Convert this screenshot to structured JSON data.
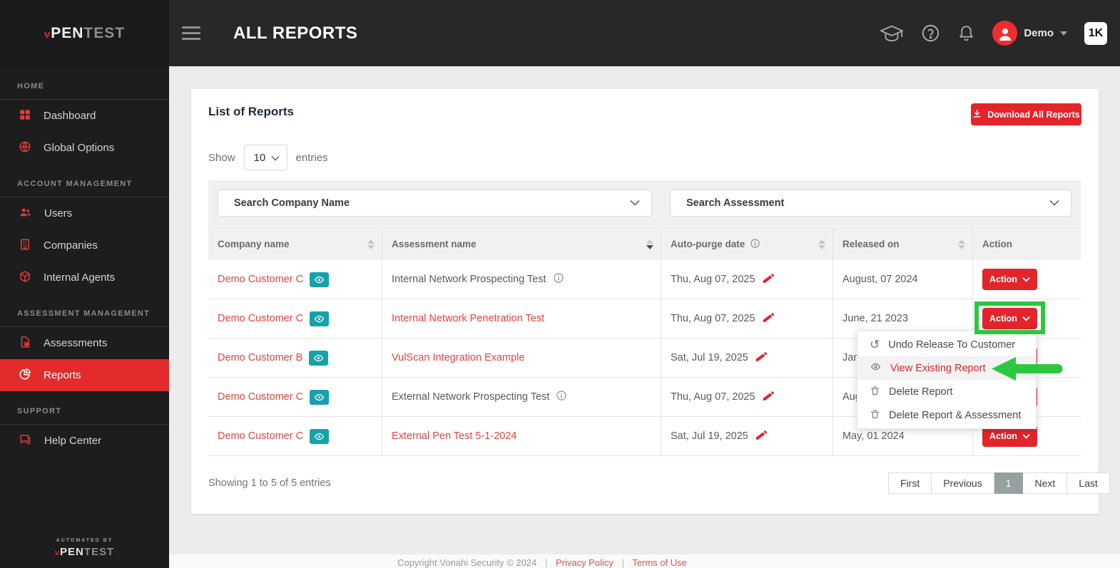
{
  "brand": {
    "v": "v",
    "pen": "PEN",
    "test": "TEST",
    "automated_by": "AUTOMATED BY"
  },
  "header": {
    "title": "ALL REPORTS",
    "user_name": "Demo",
    "corner_badge": "1K"
  },
  "sidebar": {
    "sections": [
      {
        "label": "HOME",
        "items": [
          {
            "label": "Dashboard"
          },
          {
            "label": "Global Options"
          }
        ]
      },
      {
        "label": "ACCOUNT MANAGEMENT",
        "items": [
          {
            "label": "Users"
          },
          {
            "label": "Companies"
          },
          {
            "label": "Internal Agents"
          }
        ]
      },
      {
        "label": "ASSESSMENT MANAGEMENT",
        "items": [
          {
            "label": "Assessments"
          },
          {
            "label": "Reports"
          }
        ]
      },
      {
        "label": "SUPPORT",
        "items": [
          {
            "label": "Help Center"
          }
        ]
      }
    ]
  },
  "card": {
    "title": "List of Reports",
    "download_label": "Download All Reports",
    "show_label": "Show",
    "entries_label": "entries",
    "page_size": "10",
    "search_company": "Search Company Name",
    "search_assessment": "Search Assessment",
    "table": {
      "columns": [
        "Company name",
        "Assessment name",
        "Auto-purge date",
        "Released on",
        "Action"
      ],
      "action_label": "Action",
      "rows": [
        {
          "company": "Demo Customer C",
          "assessment": "Internal Network Prospecting Test",
          "auto_purge": "Thu, Aug 07, 2025",
          "released": "August, 07 2024"
        },
        {
          "company": "Demo Customer C",
          "assessment": "Internal Network Penetration Test",
          "auto_purge": "Thu, Aug 07, 2025",
          "released": "June, 21 2023"
        },
        {
          "company": "Demo Customer B",
          "assessment": "VulScan Integration Example",
          "auto_purge": "Sat, Jul 19, 2025",
          "released": "Jan"
        },
        {
          "company": "Demo Customer C",
          "assessment": "External Network Prospecting Test",
          "auto_purge": "Thu, Aug 07, 2025",
          "released": "Aug"
        },
        {
          "company": "Demo Customer C",
          "assessment": "External Pen Test 5-1-2024",
          "auto_purge": "Sat, Jul 19, 2025",
          "released": "May, 01 2024"
        }
      ]
    },
    "summary": "Showing 1 to 5 of 5 entries",
    "pagination": {
      "first": "First",
      "previous": "Previous",
      "page": "1",
      "next": "Next",
      "last": "Last"
    }
  },
  "action_menu": {
    "items": [
      {
        "label": "Undo Release To Customer"
      },
      {
        "label": "View Existing Report"
      },
      {
        "label": "Delete Report"
      },
      {
        "label": "Delete Report & Assessment"
      }
    ]
  },
  "footer": {
    "copyright": "Copyright Vonahi Security © 2024",
    "sep": "|",
    "privacy": "Privacy Policy",
    "terms": "Terms of Use"
  },
  "colors": {
    "accent_red": "#e3242b",
    "link_red": "#e8433e",
    "teal_badge": "#15a2aa",
    "annotation_green": "#2bc83e",
    "heading_navy": "#1f2b3a"
  }
}
